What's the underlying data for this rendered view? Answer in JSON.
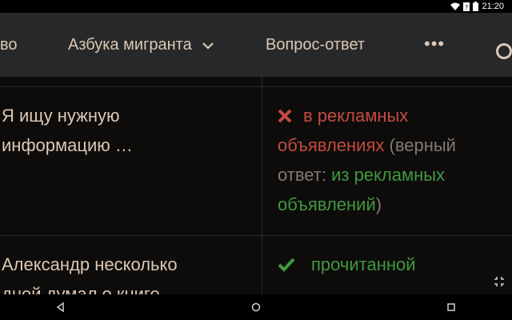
{
  "status_bar": {
    "time": "21:20",
    "icons": [
      "wifi-icon",
      "signal-icon",
      "battery-icon"
    ]
  },
  "nav": {
    "item1": "во",
    "item2": "Азбука мигранта",
    "item3": "Вопрос-ответ",
    "more_icon": "more-dots-icon",
    "search_icon": "search-icon"
  },
  "rows": [
    {
      "question": "Я ищу нужную\nинформацию …",
      "answer_wrong": "в рекламных объявлениях",
      "answer_note_prefix": " (верный ответ: ",
      "answer_correct": "из рекламных объявлений",
      "answer_note_suffix": ")",
      "result_icon": "cross-icon"
    },
    {
      "question": "Александр несколько\nдней думал о книге",
      "answer": "прочитанной",
      "result_icon": "check-icon"
    }
  ],
  "colors": {
    "wrong": "#c44a3f",
    "correct": "#40983f",
    "note": "#807a72",
    "text": "#dcc8b4"
  }
}
